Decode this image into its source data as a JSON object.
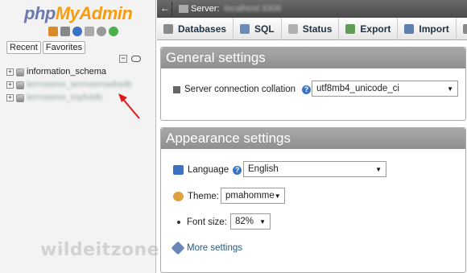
{
  "sidebar": {
    "logo_php": "php",
    "logo_myadmin": "MyAdmin",
    "tabs": [
      {
        "label": "Recent"
      },
      {
        "label": "Favorites"
      }
    ],
    "collapse_symbol": "−",
    "databases": [
      {
        "label": "information_schema",
        "expander": "+"
      },
      {
        "label": "termasmo_termasmadiadb",
        "expander": "+"
      },
      {
        "label": "termasmo_topfuldb",
        "expander": "+"
      }
    ],
    "watermark": "wildeitzone"
  },
  "topbar": {
    "back_symbol": "←",
    "server_label": "Server:",
    "server_value": "localhost:3306"
  },
  "nav": {
    "tabs": [
      {
        "label": "Databases",
        "icon": "database-icon",
        "color": "#8a8a8a"
      },
      {
        "label": "SQL",
        "icon": "sql-icon",
        "color": "#6c8cb8"
      },
      {
        "label": "Status",
        "icon": "status-icon",
        "color": "#b0b0b0"
      },
      {
        "label": "Export",
        "icon": "export-icon",
        "color": "#5f9c54"
      },
      {
        "label": "Import",
        "icon": "import-icon",
        "color": "#5d7fb0"
      },
      {
        "label": "",
        "icon": "wrench-icon",
        "color": "#888"
      }
    ]
  },
  "general": {
    "title": "General settings",
    "collation_label": "Server connection collation",
    "collation_value": "utf8mb4_unicode_ci",
    "help": "?"
  },
  "appearance": {
    "title": "Appearance settings",
    "language_label": "Language",
    "language_value": "English",
    "theme_label": "Theme:",
    "theme_value": "pmahomme",
    "fontsize_label": "Font size:",
    "fontsize_value": "82%",
    "more_label": "More settings",
    "help": "?"
  },
  "caret": "▼"
}
